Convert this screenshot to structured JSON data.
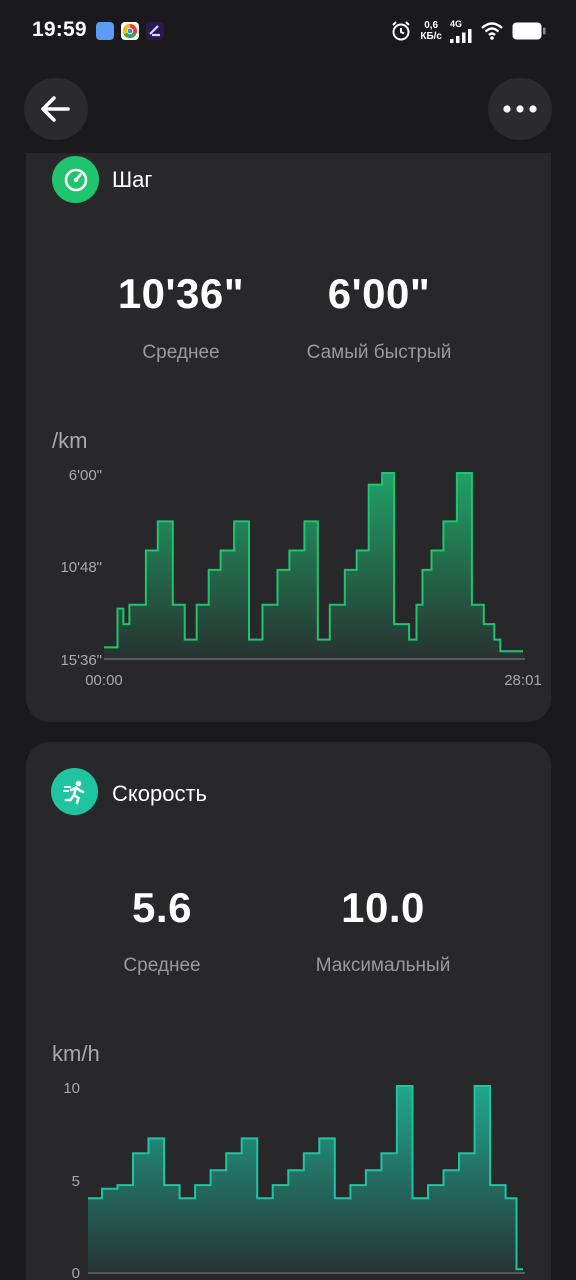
{
  "status_bar": {
    "time": "19:59",
    "net_speed_value": "0,6",
    "net_speed_unit": "КБ/с",
    "network_type": "4G",
    "icons": [
      "app-icon-blue",
      "chrome-icon",
      "app-icon-purple",
      "alarm-icon",
      "signal-icon",
      "wifi-icon",
      "battery-icon"
    ]
  },
  "toolbar": {
    "back_icon": "arrow-left-icon",
    "more_icon": "more-horizontal-icon"
  },
  "pace_card": {
    "title": "Шаг",
    "icon": "gauge-icon",
    "accent": "#1fc46e",
    "average_value": "10'36\"",
    "average_label": "Среднее",
    "fastest_value": "6'00\"",
    "fastest_label": "Самый быстрый",
    "unit": "/km",
    "y_ticks": [
      "6'00\"",
      "10'48\"",
      "15'36\""
    ],
    "x_ticks": [
      "00:00",
      "28:01"
    ]
  },
  "speed_card": {
    "title": "Скорость",
    "icon": "running-icon",
    "accent": "#1fc4a0",
    "average_value": "5.6",
    "average_label": "Среднее",
    "max_value": "10.0",
    "max_label": "Максимальный",
    "unit": "km/h",
    "y_ticks": [
      "10",
      "5",
      "0"
    ]
  },
  "chart_data": [
    {
      "type": "area",
      "title": "",
      "ylabel": "/km",
      "x_range": [
        0,
        28.02
      ],
      "y_range_minutes_per_km": [
        6.0,
        15.6
      ],
      "y_inverted": true,
      "grid": false,
      "x_minutes": [
        0,
        0.9,
        1.3,
        1.7,
        2.8,
        3.6,
        4.6,
        5.4,
        6.2,
        7.0,
        7.8,
        8.7,
        9.7,
        10.6,
        11.6,
        12.4,
        13.4,
        14.3,
        15.1,
        16.1,
        16.9,
        17.7,
        18.6,
        19.4,
        20.4,
        20.9,
        21.3,
        21.9,
        22.7,
        23.6,
        24.6,
        25.4,
        26.1,
        26.5,
        26.9
      ],
      "pace_minutes_per_km": [
        15.0,
        13.0,
        13.8,
        12.8,
        10.0,
        8.5,
        12.8,
        14.6,
        12.8,
        11.0,
        10.0,
        8.5,
        14.6,
        12.8,
        11.0,
        10.0,
        8.5,
        14.6,
        12.8,
        11.0,
        10.0,
        6.6,
        6.0,
        13.8,
        14.6,
        12.8,
        11.0,
        10.0,
        8.5,
        6.0,
        12.8,
        13.8,
        14.6,
        15.2,
        15.2
      ]
    },
    {
      "type": "area",
      "title": "",
      "ylabel": "km/h",
      "x_range": [
        0,
        28.02
      ],
      "ylim": [
        0,
        10
      ],
      "grid": false,
      "x_minutes": [
        0,
        0.9,
        1.9,
        2.9,
        3.9,
        4.9,
        5.9,
        6.9,
        7.9,
        8.9,
        9.9,
        10.9,
        11.9,
        12.9,
        13.9,
        14.9,
        15.9,
        16.9,
        17.9,
        18.9,
        19.9,
        20.9,
        21.9,
        22.9,
        23.9,
        24.9,
        25.9,
        26.9,
        27.6
      ],
      "speed_kmh": [
        4.0,
        4.5,
        4.7,
        6.4,
        7.2,
        4.7,
        4.0,
        4.7,
        5.5,
        6.4,
        7.2,
        4.0,
        4.7,
        5.5,
        6.4,
        7.2,
        4.0,
        4.7,
        5.5,
        6.4,
        10.0,
        4.0,
        4.7,
        5.5,
        6.4,
        10.0,
        4.7,
        4.0,
        0.2
      ]
    }
  ]
}
